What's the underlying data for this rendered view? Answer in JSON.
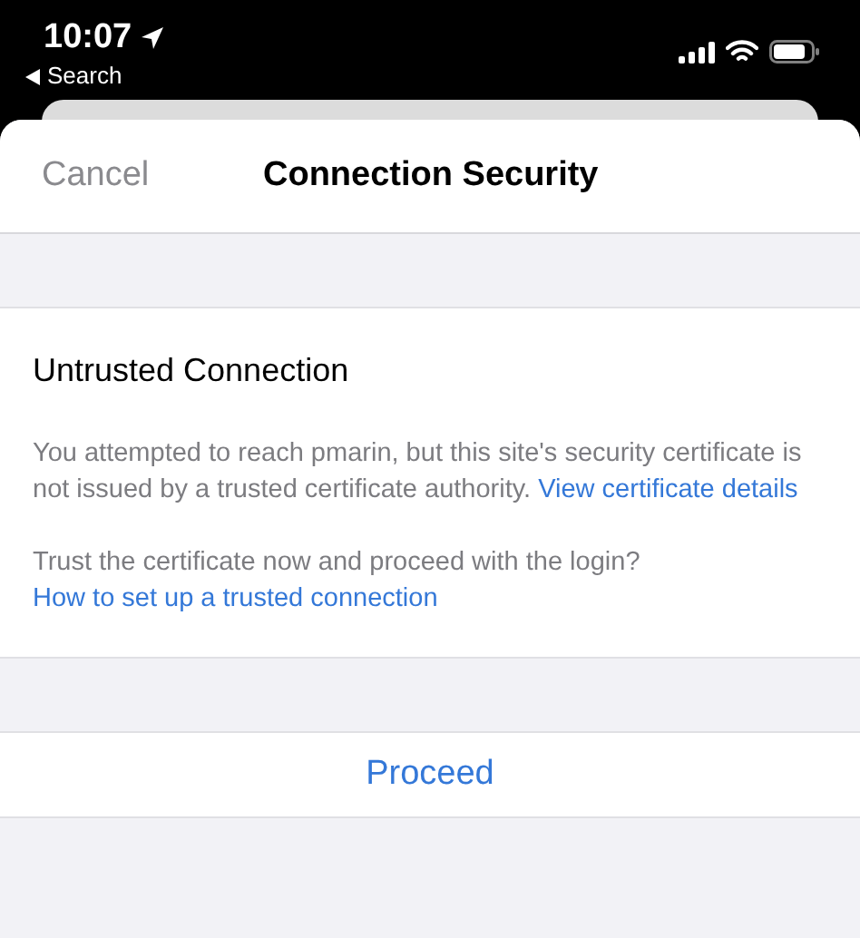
{
  "status_bar": {
    "time": "10:07",
    "back_label": "Search"
  },
  "header": {
    "cancel": "Cancel",
    "title": "Connection Security"
  },
  "section": {
    "title": "Untrusted Connection",
    "paragraphs": [
      {
        "text": "You attempted to reach pmarin, but this site's security certificate is not issued by a trusted certificate authority.",
        "link": "View certificate details"
      },
      {
        "text": "Trust the certificate now and proceed with the login?",
        "link": "How to set up a trusted connection"
      }
    ]
  },
  "action": {
    "label": "Proceed"
  }
}
